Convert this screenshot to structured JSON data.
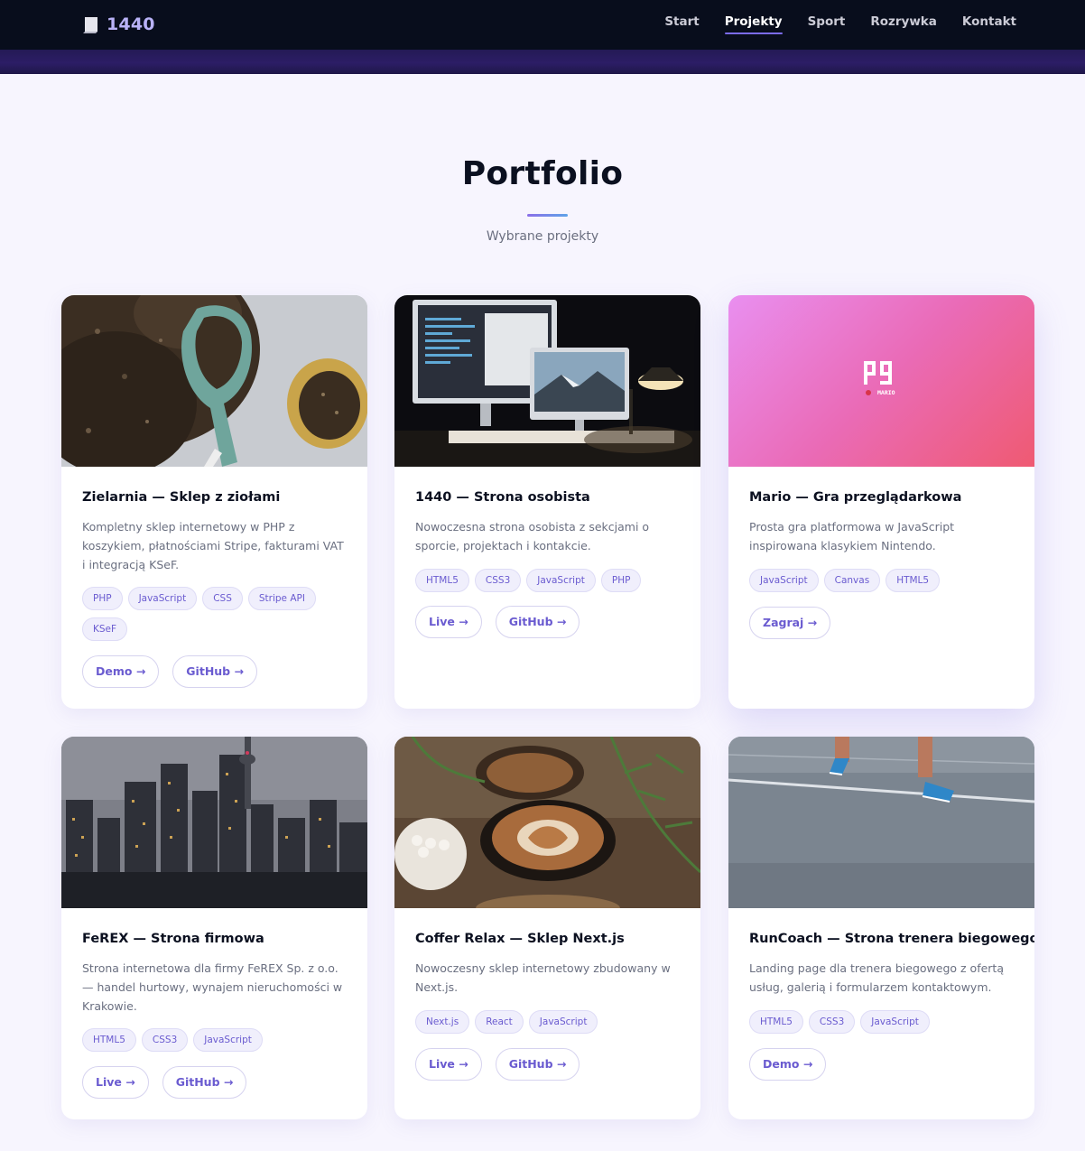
{
  "nav": {
    "brand": "1440",
    "items": [
      {
        "label": "Start",
        "active": false
      },
      {
        "label": "Projekty",
        "active": true
      },
      {
        "label": "Sport",
        "active": false
      },
      {
        "label": "Rozrywka",
        "active": false
      },
      {
        "label": "Kontakt",
        "active": false
      }
    ]
  },
  "header": {
    "title": "Portfolio",
    "subtitle": "Wybrane projekty"
  },
  "colors": {
    "accent": "#6a5bd0",
    "nav_bg": "#080d1c"
  },
  "projects": [
    {
      "title": "Zielarnia — Sklep z ziołami",
      "description": "Kompletny sklep internetowy w PHP z koszykiem, płatnościami Stripe, fakturami VAT i integracją KSeF.",
      "tags": [
        "PHP",
        "JavaScript",
        "CSS",
        "Stripe API",
        "KSeF"
      ],
      "buttons": [
        "Demo →",
        "GitHub →"
      ],
      "image": "herbs-soil-scoop-photo"
    },
    {
      "title": "1440 — Strona osobista",
      "description": "Nowoczesna strona osobista z sekcjami o sporcie, projektach i kontakcie.",
      "tags": [
        "HTML5",
        "CSS3",
        "JavaScript",
        "PHP"
      ],
      "buttons": [
        "Live →",
        "GitHub →"
      ],
      "image": "desk-monitors-photo"
    },
    {
      "title": "Mario — Gra przeglądarkowa",
      "description": "Prosta gra platformowa w JavaScript inspirowana klasykiem Nintendo.",
      "tags": [
        "JavaScript",
        "Canvas",
        "HTML5"
      ],
      "buttons": [
        "Zagraj →"
      ],
      "image": "mario-logo-gradient",
      "image_text": "MARIO"
    },
    {
      "title": "FeREX — Strona firmowa",
      "description": "Strona internetowa dla firmy FeREX Sp. z o.o. — handel hurtowy, wynajem nieruchomości w Krakowie.",
      "tags": [
        "HTML5",
        "CSS3",
        "JavaScript"
      ],
      "buttons": [
        "Live →",
        "GitHub →"
      ],
      "image": "city-skyline-photo"
    },
    {
      "title": "Coffer Relax — Sklep Next.js",
      "description": "Nowoczesny sklep internetowy zbudowany w Next.js.",
      "tags": [
        "Next.js",
        "React",
        "JavaScript"
      ],
      "buttons": [
        "Live →",
        "GitHub →"
      ],
      "image": "coffee-cups-photo"
    },
    {
      "title": "RunCoach — Strona trenera biegowego",
      "description": "Landing page dla trenera biegowego z ofertą usług, galerią i formularzem kontaktowym.",
      "tags": [
        "HTML5",
        "CSS3",
        "JavaScript"
      ],
      "buttons": [
        "Demo →"
      ],
      "image": "runner-road-photo"
    }
  ]
}
